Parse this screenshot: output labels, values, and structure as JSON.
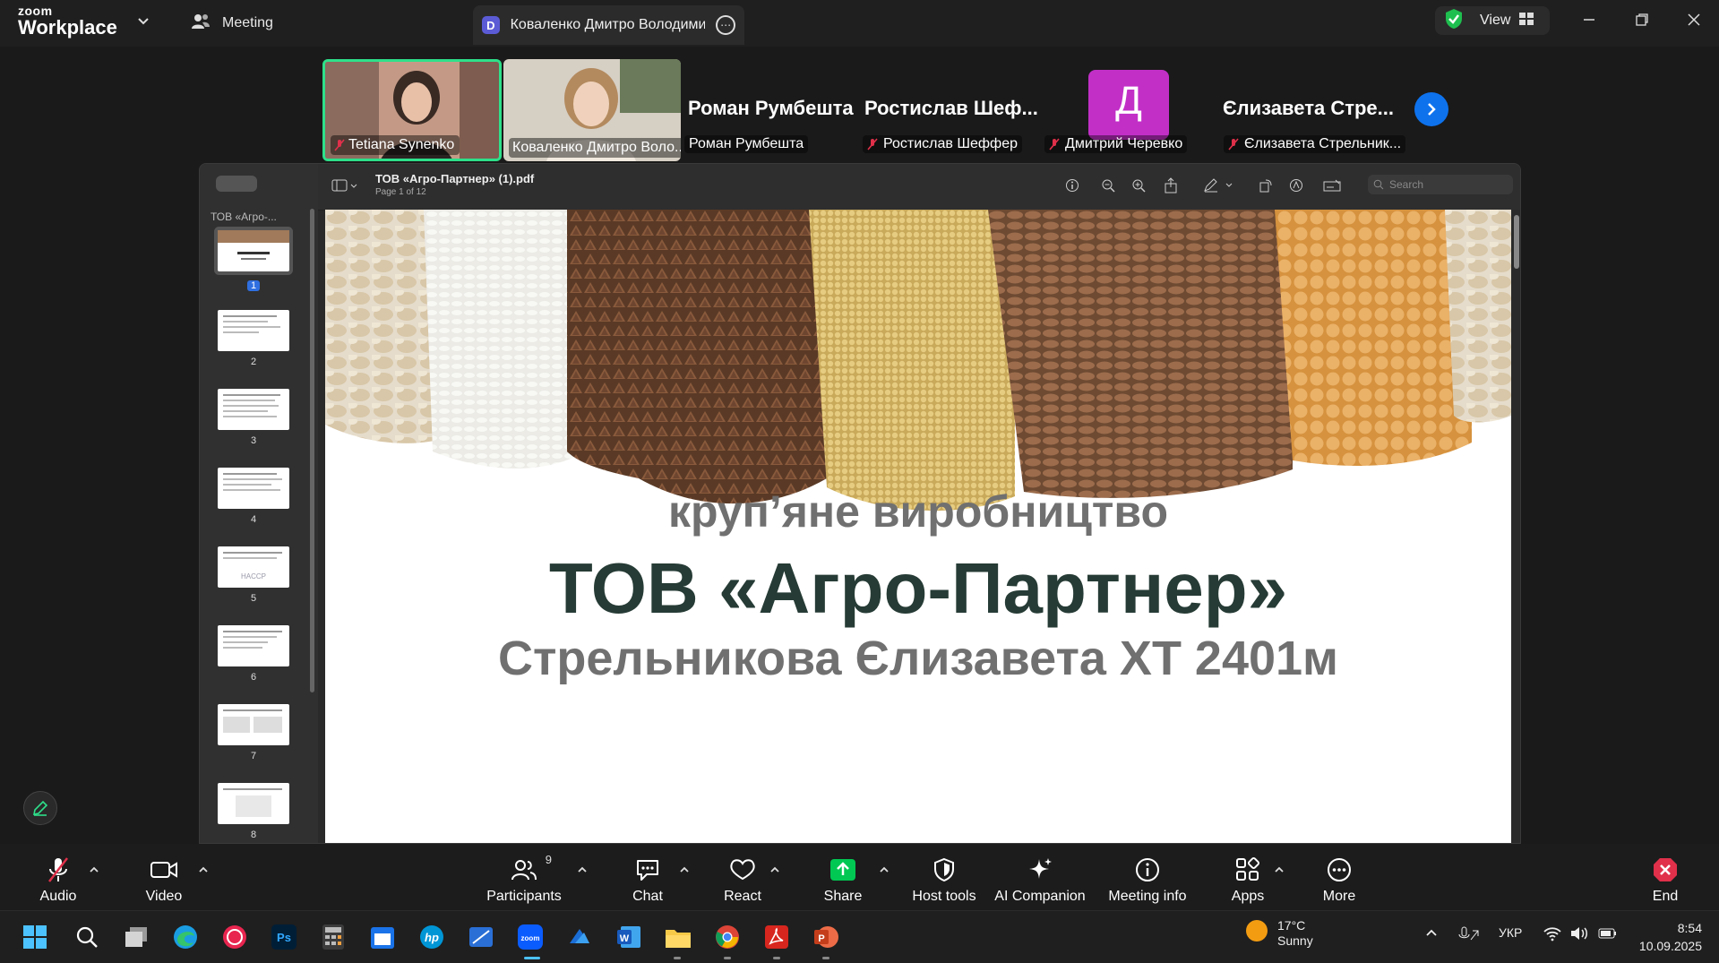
{
  "titlebar": {
    "logo_top": "zoom",
    "logo_bottom": "Workplace",
    "meeting_label": "Meeting",
    "tab_badge": "D",
    "tab_title": "Коваленко Дмитро Володимир",
    "view_label": "View"
  },
  "participants": {
    "tiles": [
      {
        "name": "Tetiana Synenko",
        "muted": true,
        "active_speaker": true
      },
      {
        "name": "Коваленко Дмитро Воло...",
        "muted": false
      },
      {
        "display": "Роман Румбешта",
        "name": "Роман Румбешта",
        "muted": false
      },
      {
        "display": "Ростислав  Шеф...",
        "name": "Ростислав Шеффер",
        "muted": true
      },
      {
        "avatar_letter": "Д",
        "name": "Дмитрий Черевко",
        "muted": true
      },
      {
        "display": "Єлизавета  Стре...",
        "name": "Єлизавета Стрельник...",
        "muted": true
      }
    ]
  },
  "viewer": {
    "sidebar_title": "ТОВ «Агро-...",
    "doc_title": "ТОВ «Агро-Партнер» (1).pdf",
    "page_info": "Page 1 of 12",
    "search_placeholder": "Search",
    "thumbs": [
      "1",
      "2",
      "3",
      "4",
      "5",
      "6",
      "7",
      "8"
    ],
    "thumb5_text": "HACCP",
    "selected_page": "1"
  },
  "slide": {
    "subtitle": "круп’яне виробництво",
    "title": "ТОВ «Агро-Партнер»",
    "author": "Стрельникова Єлизавета ХТ 2401м",
    "title_color": "#263b35",
    "subtitle_color": "#707070"
  },
  "controls": {
    "audio": "Audio",
    "video": "Video",
    "participants": "Participants",
    "participants_count": "9",
    "chat": "Chat",
    "react": "React",
    "share": "Share",
    "host_tools": "Host tools",
    "ai_companion": "AI Companion",
    "meeting_info": "Meeting info",
    "apps": "Apps",
    "more": "More",
    "end": "End"
  },
  "taskbar": {
    "weather_temp": "17°C",
    "weather_desc": "Sunny",
    "language": "УКР",
    "time": "8:54",
    "date": "10.09.2025"
  },
  "colors": {
    "zoom_blue": "#0e72ed",
    "share_green": "#00c853",
    "end_red": "#e0304a",
    "speaker_border": "#2ee08a",
    "avatar_purple": "#c22fc7"
  }
}
